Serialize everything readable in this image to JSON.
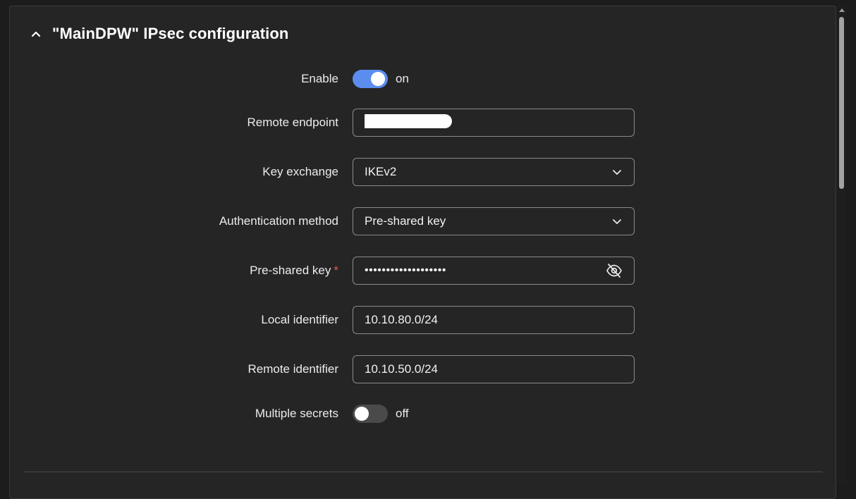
{
  "section": {
    "title": "\"MainDPW\" IPsec configuration",
    "collapse_icon": "chevron-up-icon"
  },
  "form": {
    "enable": {
      "label": "Enable",
      "state": "on",
      "checked": true
    },
    "remote_endpoint": {
      "label": "Remote endpoint",
      "value": ""
    },
    "key_exchange": {
      "label": "Key exchange",
      "value": "IKEv2"
    },
    "auth_method": {
      "label": "Authentication method",
      "value": "Pre-shared key"
    },
    "psk": {
      "label": "Pre-shared key",
      "required_mark": "*",
      "value": "•••••••••••••••••••"
    },
    "local_identifier": {
      "label": "Local identifier",
      "value": "10.10.80.0/24"
    },
    "remote_identifier": {
      "label": "Remote identifier",
      "value": "10.10.50.0/24"
    },
    "multiple_secrets": {
      "label": "Multiple secrets",
      "state": "off",
      "checked": false
    }
  },
  "colors": {
    "accent": "#5b8def",
    "required": "#e05a4f",
    "panel_bg": "#252525",
    "page_bg": "#1c1c1c"
  },
  "icons": {
    "dropdown": "chevron-down-icon",
    "reveal": "eye-off-icon"
  }
}
